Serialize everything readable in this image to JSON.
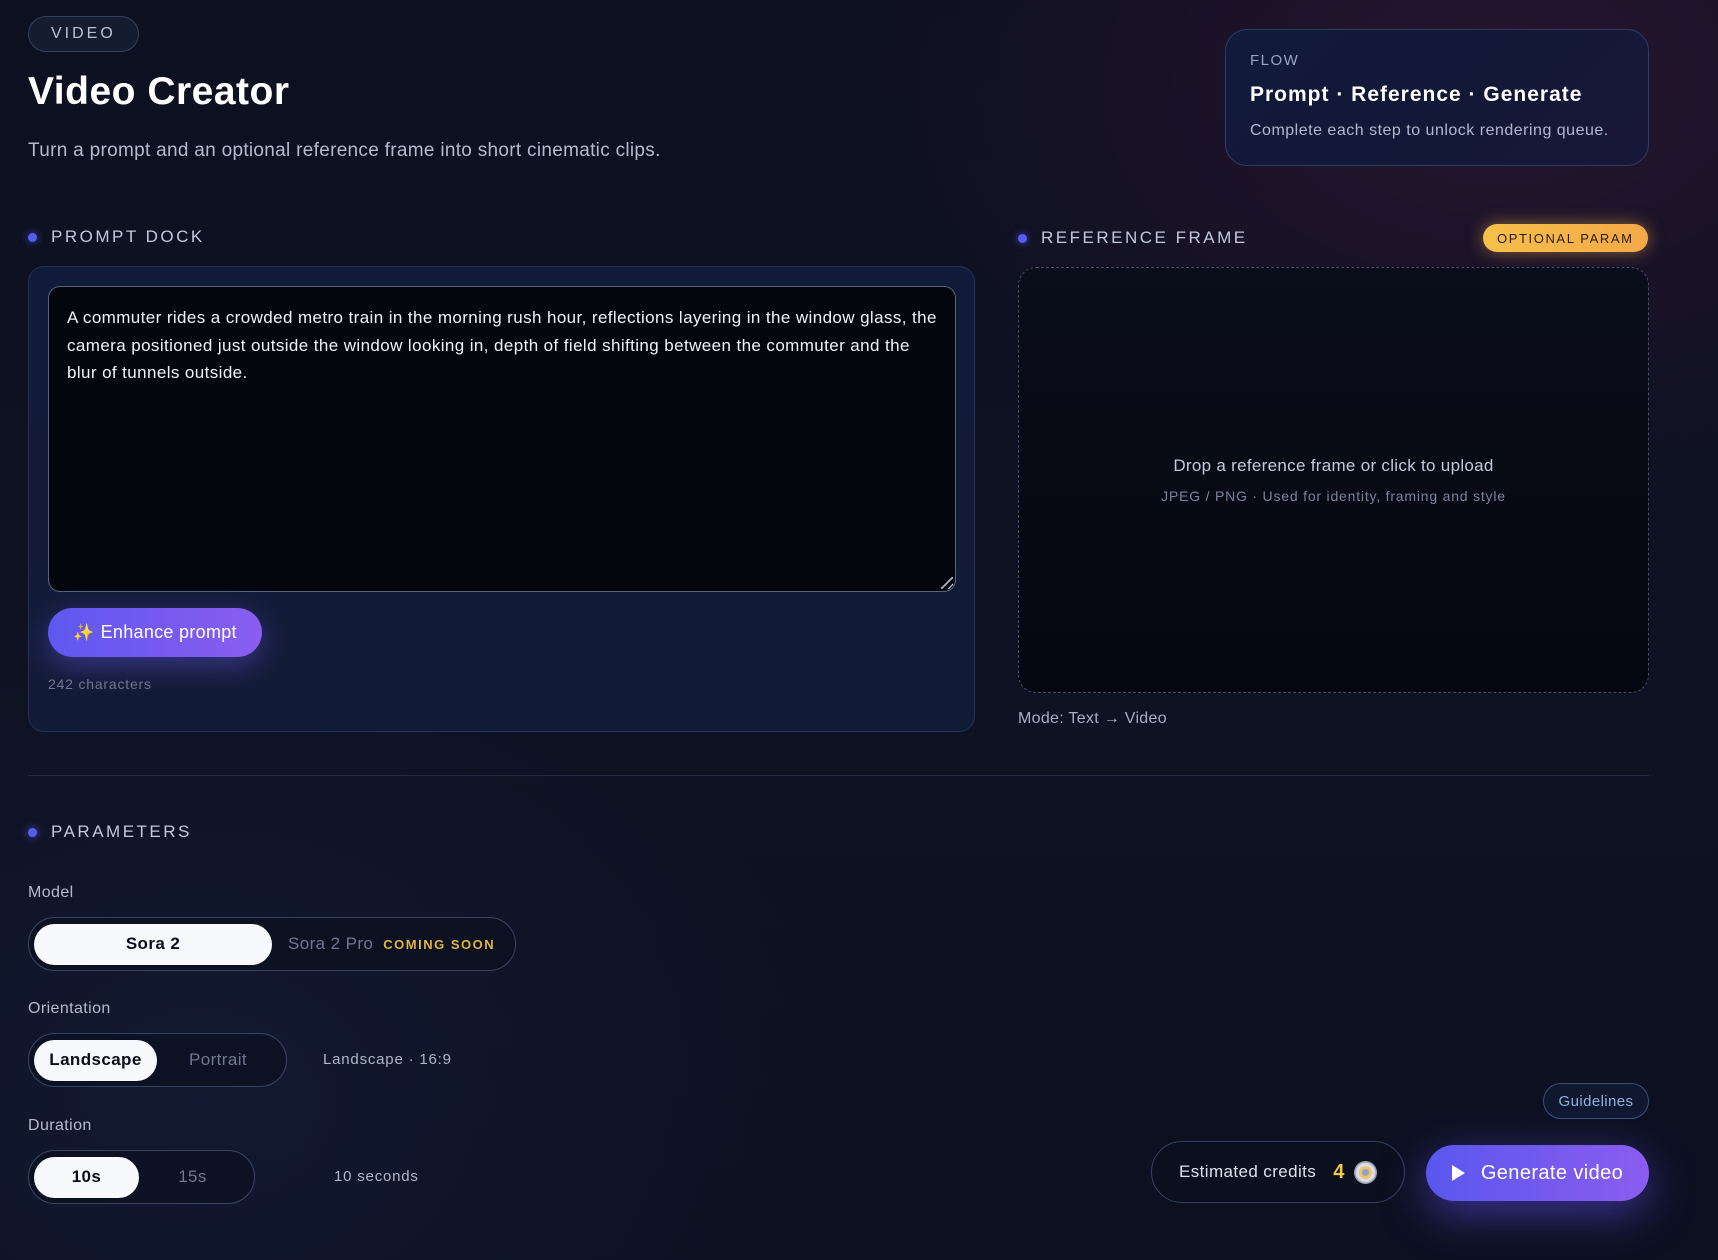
{
  "header": {
    "tag": "VIDEO",
    "title": "Video Creator",
    "subtitle": "Turn a prompt and an optional reference frame into short cinematic clips."
  },
  "flow": {
    "label": "FLOW",
    "steps": "Prompt · Reference · Generate",
    "description": "Complete each step to unlock rendering queue."
  },
  "prompt_dock": {
    "heading": "PROMPT DOCK",
    "value": "A commuter rides a crowded metro train in the morning rush hour, reflections layering in the window glass, the camera positioned just outside the window looking in, depth of field shifting between the commuter and the blur of tunnels outside.",
    "enhance_icon": "sparkles-icon",
    "enhance_glyph": "✨",
    "enhance_label": "Enhance prompt",
    "char_count": "242 characters"
  },
  "reference_frame": {
    "heading": "REFERENCE FRAME",
    "badge": "OPTIONAL PARAM",
    "drop_title": "Drop a reference frame or click to upload",
    "drop_subtitle": "JPEG / PNG · Used for identity, framing and style",
    "mode": "Mode: Text → Video"
  },
  "parameters": {
    "heading": "PARAMETERS",
    "model": {
      "label": "Model",
      "options": [
        "Sora 2",
        "Sora 2 Pro"
      ],
      "selected": "Sora 2",
      "coming_soon": "COMING SOON"
    },
    "orientation": {
      "label": "Orientation",
      "options": [
        "Landscape",
        "Portrait"
      ],
      "selected": "Landscape",
      "note": "Landscape · 16:9"
    },
    "duration": {
      "label": "Duration",
      "options": [
        "10s",
        "15s"
      ],
      "selected": "10s",
      "note": "10 seconds"
    }
  },
  "footer": {
    "guidelines_label": "Guidelines",
    "credits_label": "Estimated credits",
    "credits_value": "4",
    "credits_icon": "coin-icon",
    "generate_icon": "play-icon",
    "generate_label": "Generate video"
  },
  "colors": {
    "accent": "#5a5cf0",
    "accent_gradient_end": "#8b5cf0",
    "badge": "#f6c04a",
    "credits": "#f5c746"
  }
}
